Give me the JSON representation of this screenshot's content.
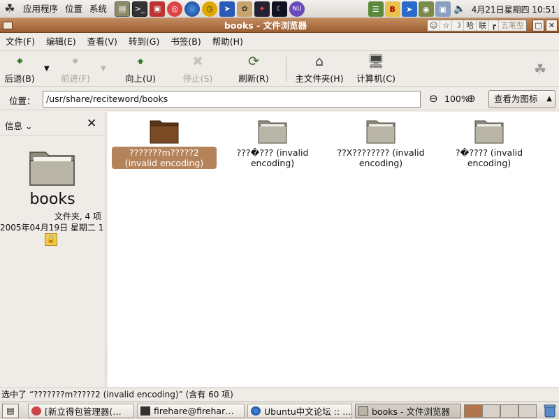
{
  "top_panel": {
    "menus": [
      "应用程序",
      "位置",
      "系统"
    ],
    "launchers": [
      "terminal-icon",
      "package-manager-icon",
      "help-icon",
      "web-browser-icon",
      "clock-app-icon",
      "bird-icon",
      "rabbit-icon",
      "star-app-icon",
      "moon-app-icon",
      "gnu-icon"
    ],
    "tray": [
      "books-app-icon",
      "dictionary-icon",
      "update-icon",
      "network-icon",
      "screen-icon"
    ],
    "clock": "4月21日星期四 10:51"
  },
  "window": {
    "title": "books - 文件浏览器",
    "input_method": [
      "☺",
      "☆",
      "☽",
      "哈",
      "联",
      "┏",
      "五笔型"
    ]
  },
  "menubar": [
    "文件(F)",
    "编辑(E)",
    "查看(V)",
    "转到(G)",
    "书签(B)",
    "帮助(H)"
  ],
  "toolbar": {
    "back": "后退(B)",
    "forward": "前进(F)",
    "up": "向上(U)",
    "stop": "停止(S)",
    "reload": "刷新(R)",
    "home": "主文件夹(H)",
    "computer": "计算机(C)"
  },
  "location": {
    "label": "位置：",
    "path": "/usr/share/reciteword/books",
    "zoom": "100%",
    "view_mode": "查看为图标"
  },
  "sidebar": {
    "selector": "信息",
    "folder_name": "books",
    "info": "文件夹, 4 项",
    "date": "2005年04月19日 星期二 1"
  },
  "files": [
    {
      "name": "???????m?????2 (invalid encoding)",
      "selected": true,
      "color": "brown"
    },
    {
      "name": "???�??? (invalid encoding)",
      "selected": false,
      "color": "gray"
    },
    {
      "name": "??X???????? (invalid encoding)",
      "selected": false,
      "color": "gray"
    },
    {
      "name": "?�???? (invalid encoding)",
      "selected": false,
      "color": "gray"
    }
  ],
  "status": "选中了 “???????m?????2 (invalid encoding)” (含有 60 项)",
  "taskbar": {
    "tasks": [
      {
        "label": "[新立得包管理器(…",
        "active": false
      },
      {
        "label": "firehare@firehar…",
        "active": false
      },
      {
        "label": "Ubuntu中文论坛 :: …",
        "active": false
      },
      {
        "label": "books - 文件浏览器",
        "active": true
      }
    ]
  },
  "colors": {
    "titlebar": "#a96a3d",
    "selection": "#b5835a",
    "folder_selected": "#7a4a24",
    "folder_normal": "#b9b6a8"
  }
}
